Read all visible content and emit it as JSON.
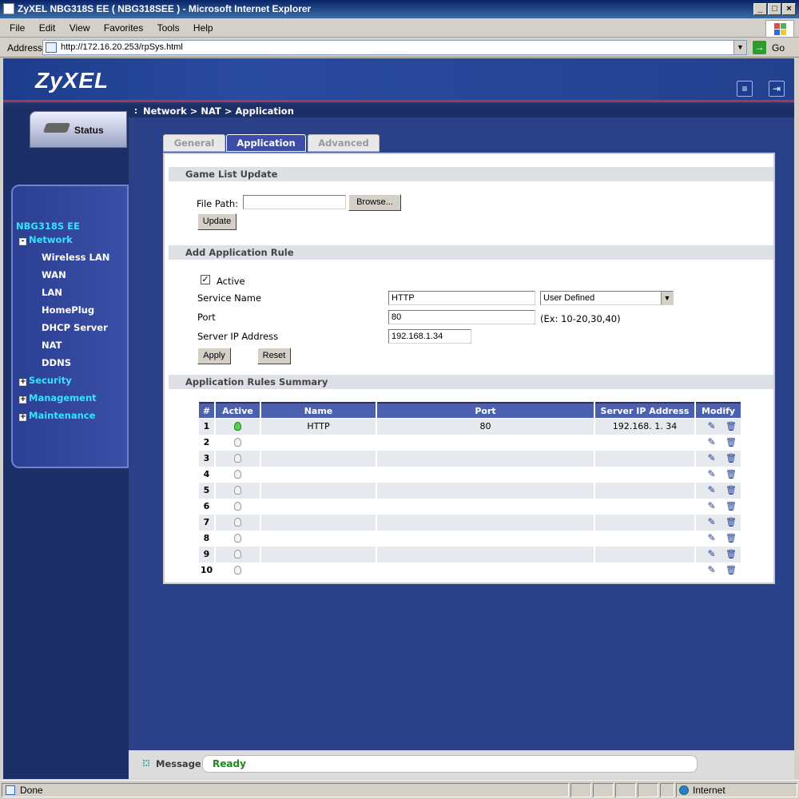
{
  "window": {
    "title": "ZyXEL NBG318S EE ( NBG318SEE ) - Microsoft Internet Explorer"
  },
  "menu": [
    "File",
    "Edit",
    "View",
    "Favorites",
    "Tools",
    "Help"
  ],
  "address": {
    "label": "Address",
    "url": "http://172.16.20.253/rpSys.html",
    "go_label": "Go"
  },
  "brand": {
    "logo": "ZyXEL"
  },
  "sidebar": {
    "status_label": "Status",
    "device": "NBG318S EE",
    "network_label": "Network",
    "network_items": [
      "Wireless LAN",
      "WAN",
      "LAN",
      "HomePlug",
      "DHCP Server",
      "NAT",
      "DDNS"
    ],
    "security_label": "Security",
    "management_label": "Management",
    "maintenance_label": "Maintenance"
  },
  "breadcrumb": "Network > NAT > Application",
  "tabs": {
    "general": "General",
    "application": "Application",
    "advanced": "Advanced"
  },
  "game_list": {
    "title": "Game List Update",
    "file_path_label": "File Path:",
    "file_path_value": "",
    "browse_label": "Browse...",
    "update_label": "Update"
  },
  "add_rule": {
    "title": "Add Application Rule",
    "active_label": "Active",
    "active_checked": true,
    "service_name_label": "Service Name",
    "service_name_value": "HTTP",
    "service_select": "User Defined",
    "port_label": "Port",
    "port_value": "80",
    "port_hint": "(Ex: 10-20,30,40)",
    "server_ip_label": "Server IP Address",
    "server_ip_value": "192.168.1.34",
    "apply_label": "Apply",
    "reset_label": "Reset"
  },
  "summary": {
    "title": "Application Rules Summary",
    "headers": [
      "#",
      "Active",
      "Name",
      "Port",
      "Server IP Address",
      "Modify"
    ],
    "rows": [
      {
        "num": "1",
        "active": true,
        "name": "HTTP",
        "port": "80",
        "ip": "192.168. 1. 34"
      },
      {
        "num": "2",
        "active": false,
        "name": "",
        "port": "",
        "ip": ""
      },
      {
        "num": "3",
        "active": false,
        "name": "",
        "port": "",
        "ip": ""
      },
      {
        "num": "4",
        "active": false,
        "name": "",
        "port": "",
        "ip": ""
      },
      {
        "num": "5",
        "active": false,
        "name": "",
        "port": "",
        "ip": ""
      },
      {
        "num": "6",
        "active": false,
        "name": "",
        "port": "",
        "ip": ""
      },
      {
        "num": "7",
        "active": false,
        "name": "",
        "port": "",
        "ip": ""
      },
      {
        "num": "8",
        "active": false,
        "name": "",
        "port": "",
        "ip": ""
      },
      {
        "num": "9",
        "active": false,
        "name": "",
        "port": "",
        "ip": ""
      },
      {
        "num": "10",
        "active": false,
        "name": "",
        "port": "",
        "ip": ""
      }
    ]
  },
  "message": {
    "label": "Message",
    "text": "Ready"
  },
  "statusbar": {
    "left": "Done",
    "zone": "Internet"
  }
}
